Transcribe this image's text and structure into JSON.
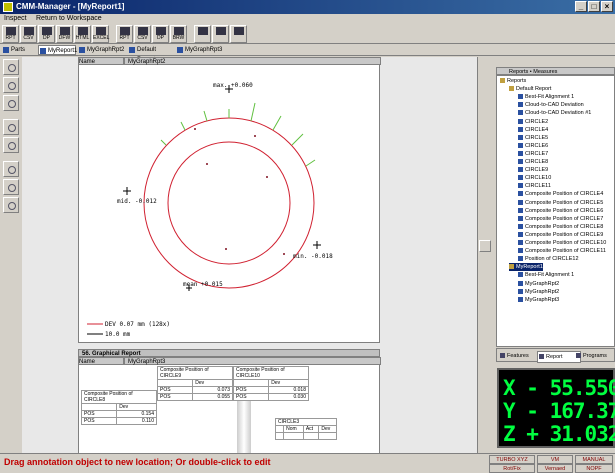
{
  "window": {
    "title": "CMM-Manager - [MyReport1]"
  },
  "menu": [
    "Inspect",
    "Return to Workspace"
  ],
  "toolbar": [
    {
      "label": "RPT",
      "icon": "report-icon"
    },
    {
      "label": "CSV",
      "icon": "csv-icon"
    },
    {
      "label": "DP",
      "icon": "dp-icon"
    },
    {
      "label": "DFW",
      "icon": "dfw-icon"
    },
    {
      "label": "HTML",
      "icon": "html-icon"
    },
    {
      "label": "EXCEL",
      "icon": "excel-icon"
    },
    {
      "label": "RPT",
      "icon": "report-icon"
    },
    {
      "label": "CSV",
      "icon": "csv-icon"
    },
    {
      "label": "DP",
      "icon": "dp-icon"
    },
    {
      "label": "BRW",
      "icon": "browse-icon"
    },
    {
      "label": "",
      "icon": "print-icon"
    },
    {
      "label": "",
      "icon": "calculator-icon"
    },
    {
      "label": "",
      "icon": "exit-icon"
    }
  ],
  "tabs": [
    "Parts",
    "MyReport1",
    "MyGraphRpt2",
    "Default Report",
    "MyGraphRpt3"
  ],
  "graph1": {
    "header_name": "Name",
    "header_value": "MyGraphRpt2",
    "labels": {
      "max": "max. +0.060",
      "mid": "mid. -0.012",
      "min": "min. -0.018",
      "mean": "mean +0.015"
    },
    "legend_dev": "DEV 0.07 mm (128x)",
    "legend_scale": "10.0 mm"
  },
  "graph2": {
    "title": "56. Graphical Report",
    "header_name": "Name",
    "header_value": "MyGraphRpt3",
    "box1": {
      "title": "Composite Position of CIRCLE9",
      "col": "Dev",
      "rows": [
        [
          "POS",
          "0.073"
        ],
        [
          "POS",
          "0.055"
        ]
      ]
    },
    "box2": {
      "title": "Composite Position of CIRCLE10",
      "col": "Dev",
      "rows": [
        [
          "POS",
          "0.018"
        ],
        [
          "POS",
          "0.030"
        ]
      ]
    },
    "box3": {
      "title": "Composite Position of CIRCLE8",
      "col": "Dev",
      "rows": [
        [
          "POS",
          "0.154"
        ],
        [
          "POS",
          "0.110"
        ]
      ]
    },
    "box4": {
      "title": "CIRCLE3",
      "cols": [
        "Nom",
        "Act",
        "Dev"
      ]
    }
  },
  "tree": {
    "header": "Reports • Measures",
    "items": [
      {
        "label": "Reports",
        "level": 0,
        "folder": true
      },
      {
        "label": "Default Report",
        "level": 1,
        "folder": true
      },
      {
        "label": "Best-Fit Alignment 1",
        "level": 2
      },
      {
        "label": "Cloud-to-CAD Deviation",
        "level": 2
      },
      {
        "label": "Cloud-to-CAD Deviation #1",
        "level": 2
      },
      {
        "label": "CIRCLE2",
        "level": 2
      },
      {
        "label": "CIRCLE4",
        "level": 2
      },
      {
        "label": "CIRCLE5",
        "level": 2
      },
      {
        "label": "CIRCLE6",
        "level": 2
      },
      {
        "label": "CIRCLE7",
        "level": 2
      },
      {
        "label": "CIRCLE8",
        "level": 2
      },
      {
        "label": "CIRCLE9",
        "level": 2
      },
      {
        "label": "CIRCLE10",
        "level": 2
      },
      {
        "label": "CIRCLE11",
        "level": 2
      },
      {
        "label": "Composite Position of CIRCLE4",
        "level": 2
      },
      {
        "label": "Composite Position of CIRCLE5",
        "level": 2
      },
      {
        "label": "Composite Position of CIRCLE6",
        "level": 2
      },
      {
        "label": "Composite Position of CIRCLE7",
        "level": 2
      },
      {
        "label": "Composite Position of CIRCLE8",
        "level": 2
      },
      {
        "label": "Composite Position of CIRCLE9",
        "level": 2
      },
      {
        "label": "Composite Position of CIRCLE10",
        "level": 2
      },
      {
        "label": "Composite Position of CIRCLE11",
        "level": 2
      },
      {
        "label": "Position of CIRCLE12",
        "level": 2
      },
      {
        "label": "MyReport1",
        "level": 1,
        "folder": true,
        "selected": true
      },
      {
        "label": "Best-Fit Alignment 1",
        "level": 2
      },
      {
        "label": "MyGraphRpt2",
        "level": 2
      },
      {
        "label": "MyGraphRpt2",
        "level": 2
      },
      {
        "label": "MyGraphRpt3",
        "level": 2
      }
    ]
  },
  "right_tabs": [
    "Features",
    "Report",
    "Programs"
  ],
  "dro": {
    "x": "X - 55.550",
    "y": "Y - 167.376",
    "z": "Z + 31.032"
  },
  "status": {
    "message": "Drag annotation object to new location; Or double-click to edit",
    "boxes": [
      [
        "TURBO XYZ",
        "VM",
        "MANUAL"
      ],
      [
        "Rot/Fix",
        "Vernaed",
        "NOPF"
      ]
    ]
  }
}
